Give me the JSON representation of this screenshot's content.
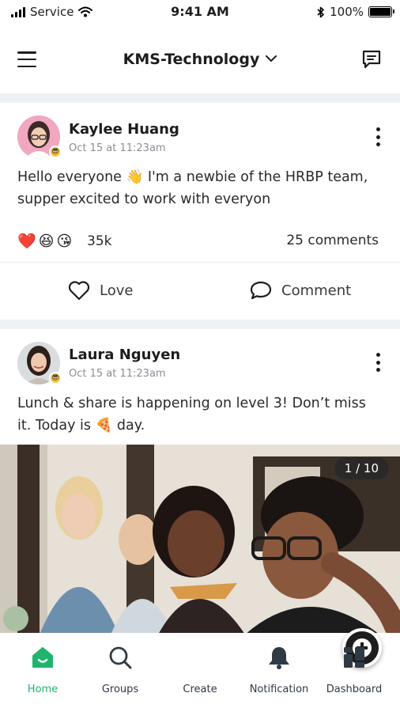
{
  "status_bar": {
    "carrier": "Service",
    "time": "9:41 AM",
    "battery_percent": "100%",
    "battery_level": 1.0,
    "icons": [
      "signal-icon",
      "wifi-icon",
      "bluetooth-icon",
      "battery-icon"
    ]
  },
  "header": {
    "org_name": "KMS-Technology",
    "left_icon": "hamburger-menu-icon",
    "right_icon": "chat-icon",
    "dropdown_icon": "chevron-down-icon"
  },
  "posts": [
    {
      "author": "Kaylee Huang",
      "timestamp": "Oct 15 at 11:23am",
      "text": "Hello everyone 👋 I'm a newbie of the HRBP team, supper excited to work with everyon",
      "reactions": [
        "❤️",
        "😆",
        "😘"
      ],
      "reaction_count": "35k",
      "comments_label": "25 comments",
      "actions": {
        "love": "Love",
        "comment": "Comment"
      }
    },
    {
      "author": "Laura Nguyen",
      "timestamp": "Oct 15 at 11:23am",
      "text": "Lunch & share is happening on level 3! Don’t miss it. Today is 🍕 day.",
      "photo_counter": "1 / 10"
    }
  ],
  "tab_bar": {
    "active": "Home",
    "tabs": [
      {
        "label": "Home",
        "icon": "home-icon"
      },
      {
        "label": "Groups",
        "icon": "search-icon"
      },
      {
        "label": "Create",
        "icon": "plus-circle-icon"
      },
      {
        "label": "Notification",
        "icon": "bell-icon"
      },
      {
        "label": "Dashboard",
        "icon": "dashboard-icon"
      }
    ]
  },
  "colors": {
    "accent": "#1fb46e",
    "divider": "#eef2f4",
    "text": "#1d1d1f",
    "muted": "#8a8f95"
  }
}
